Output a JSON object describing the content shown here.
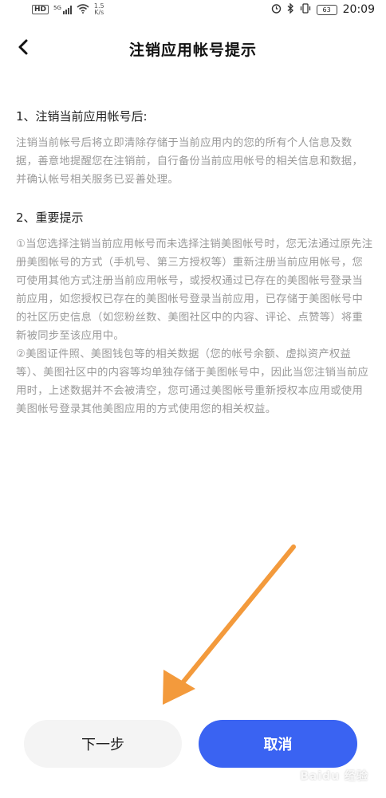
{
  "status_bar": {
    "hd": "HD",
    "network": "5G",
    "speed": "1.5",
    "speed_unit": "K/s",
    "battery": "63",
    "time": "20:09"
  },
  "nav": {
    "title": "注销应用帐号提示"
  },
  "section1": {
    "heading": "1、注销当前应用帐号后:",
    "body": "注销当前帐号后将立即清除存储于当前应用内的您的所有个人信息及数据，善意地提醒您在注销前，自行备份当前应用帐号的相关信息和数据，并确认帐号相关服务已妥善处理。"
  },
  "section2": {
    "heading": "2、重要提示",
    "para1": "①当您选择注销当前应用帐号而未选择注销美图帐号时，您无法通过原先注册美图帐号的方式（手机号、第三方授权等）重新注册当前应用帐号，您可使用其他方式注册当前应用帐号，或授权通过已存在的美图帐号登录当前应用，如您授权已存在的美图帐号登录当前应用，已存储于美图帐号中的社区历史信息（如您粉丝数、美图社区中的内容、评论、点赞等）将重新被同步至该应用中。",
    "para2": "②美图证件照、美图钱包等的相关数据（您的帐号余额、虚拟资产权益等）、美图社区中的内容等均单独存储于美图帐号中，因此当您注销当前应用时，上述数据并不会被清空，您可通过美图帐号重新授权本应用或使用美图帐号登录其他美图应用的方式使用您的相关权益。"
  },
  "buttons": {
    "next_label": "下一步",
    "cancel_label": "取消"
  },
  "watermark": "Baidu 经验",
  "colors": {
    "primary": "#3a63f2",
    "secondary_bg": "#f4f4f4",
    "annotation": "#f39a3c",
    "muted_text": "#9a9a9a"
  },
  "icons": {
    "back": "chevron-left-icon",
    "wifi": "wifi-icon",
    "signal": "signal-icon",
    "alarm": "alarm-icon",
    "bluetooth": "bluetooth-icon",
    "vibrate": "vibrate-icon",
    "battery": "battery-icon"
  }
}
